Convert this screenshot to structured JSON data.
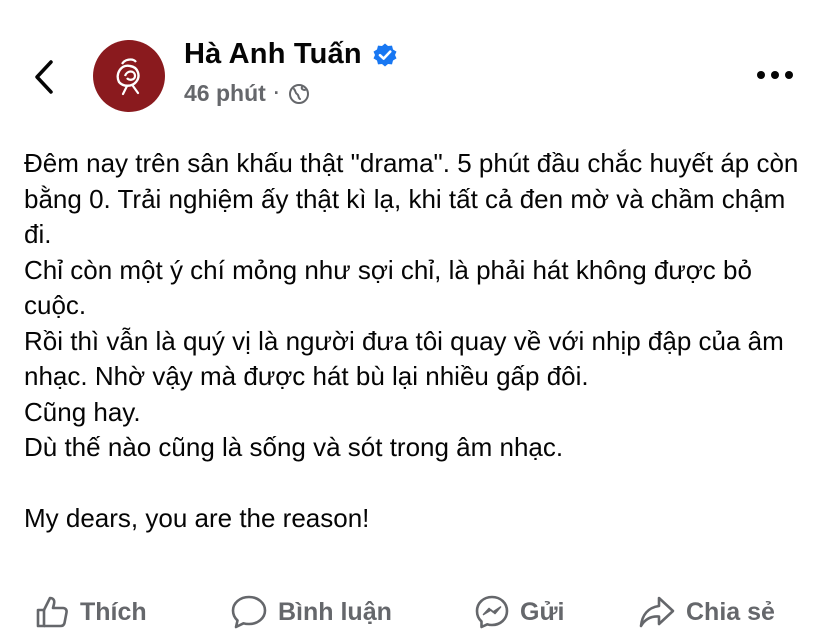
{
  "header": {
    "back_icon": "chevron-left-icon",
    "author_name": "Hà Anh Tuấn",
    "verified_icon": "verified-badge-icon",
    "timestamp": "46 phút",
    "separator": "·",
    "privacy_icon": "globe-icon",
    "more_icon": "more-horizontal-icon"
  },
  "post": {
    "lines": [
      "Đêm nay trên sân khấu thật \"drama\". 5 phút đầu chắc huyết áp còn bằng 0. Trải nghiệm ấy thật kì lạ, khi tất cả đen mờ và chầm chậm đi.",
      "Chỉ còn một ý chí mỏng như sợi chỉ, là phải hát không được bỏ cuộc.",
      "Rồi thì vẫn là quý vị là người đưa tôi quay về với nhịp đập của âm nhạc. Nhờ vậy mà được hát bù lại nhiều gấp đôi.",
      "Cũng hay.",
      "Dù thế nào cũng là sống và sót trong âm nhạc.",
      "My dears, you are the reason!"
    ]
  },
  "actions": {
    "like_label": "Thích",
    "comment_label": "Bình luận",
    "send_label": "Gửi",
    "share_label": "Chia sẻ"
  },
  "colors": {
    "text": "#050505",
    "muted": "#65676b",
    "verified": "#1877f2",
    "avatar_bg": "#8a1a1e"
  }
}
